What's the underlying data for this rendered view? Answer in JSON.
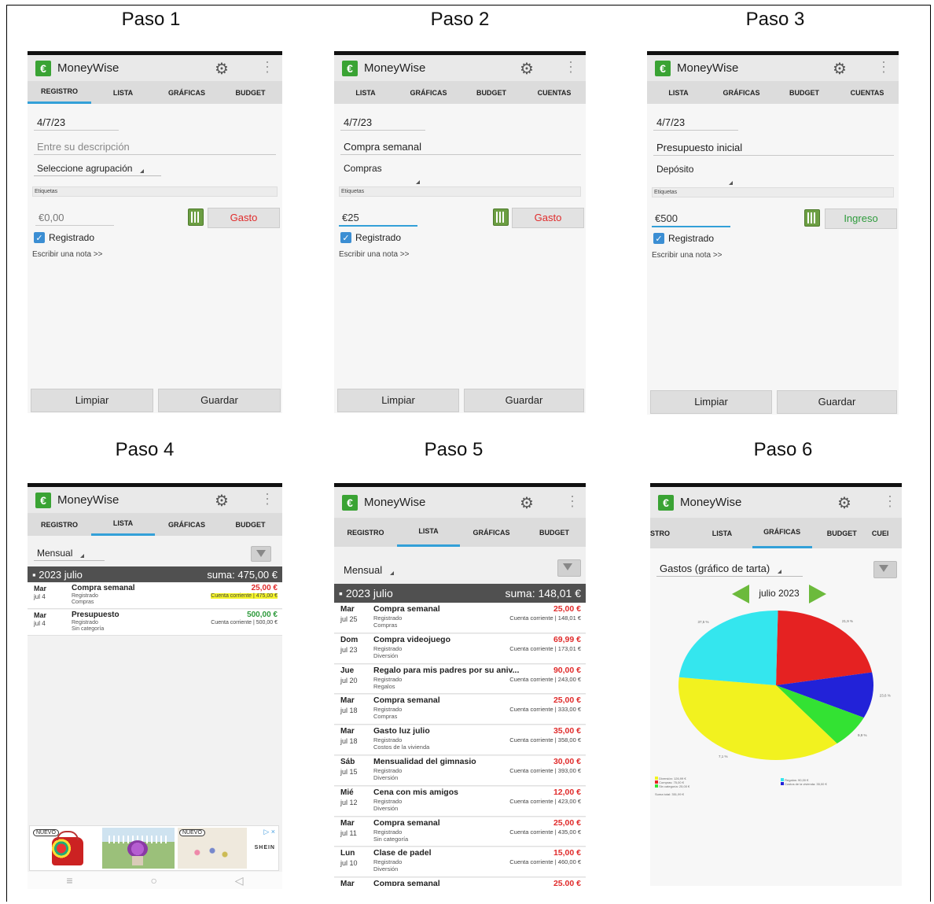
{
  "steps": [
    "Paso 1",
    "Paso 2",
    "Paso 3",
    "Paso 4",
    "Paso 5",
    "Paso 6"
  ],
  "app": {
    "logo": "€",
    "title": "MoneyWise",
    "gear_icon": "gear-icon",
    "menu_icon": "overflow-menu-icon"
  },
  "s1": {
    "tabs": [
      "REGISTRO",
      "LISTA",
      "GRÁFICAS",
      "BUDGET"
    ],
    "date": "4/7/23",
    "description_placeholder": "Entre su descripción",
    "group": "Seleccione agrupación",
    "tags": "Etiquetas",
    "amount": "€0,00",
    "type": "Gasto",
    "checked": "Registrado",
    "note": "Escribir una nota >>",
    "clear": "Limpiar",
    "save": "Guardar"
  },
  "s2": {
    "tabs": [
      "LISTA",
      "GRÁFICAS",
      "BUDGET",
      "CUENTAS"
    ],
    "date": "4/7/23",
    "description": "Compra semanal",
    "group": "Compras",
    "tags": "Etiquetas",
    "amount": "€25",
    "type": "Gasto",
    "checked": "Registrado",
    "note": "Escribir una nota >>",
    "clear": "Limpiar",
    "save": "Guardar"
  },
  "s3": {
    "tabs": [
      "LISTA",
      "GRÁFICAS",
      "BUDGET",
      "CUENTAS"
    ],
    "date": "4/7/23",
    "description": "Presupuesto inicial",
    "group": "Depósito",
    "tags": "Etiquetas",
    "amount": "€500",
    "type": "Ingreso",
    "checked": "Registrado",
    "note": "Escribir una nota >>",
    "clear": "Limpiar",
    "save": "Guardar"
  },
  "s4": {
    "tabs": [
      "REGISTRO",
      "LISTA",
      "GRÁFICAS",
      "BUDGET"
    ],
    "period": "Mensual",
    "month": "2023 julio",
    "sum": "suma: 475,00 €",
    "rows": [
      {
        "day": "Mar",
        "date": "jul 4",
        "title": "Compra semanal",
        "status": "Registrado",
        "cat": "Compras",
        "amount": "25,00 €",
        "account": "Cuenta corriente | 475,00 €",
        "kind": "expense"
      },
      {
        "day": "Mar",
        "date": "jul 4",
        "title": "Presupuesto",
        "status": "Registrado",
        "cat": "Sin categoría",
        "amount": "500,00 €",
        "account": "Cuenta corriente | 500,00 €",
        "kind": "income"
      }
    ],
    "ad": {
      "badge1": "NUEVO",
      "badge2": "NUEVO",
      "brand": "SHEIN",
      "adchoices": "▷ ×"
    },
    "nav": [
      "≡",
      "○",
      "◁"
    ]
  },
  "s5": {
    "tabs": [
      "REGISTRO",
      "LISTA",
      "GRÁFICAS",
      "BUDGET"
    ],
    "period": "Mensual",
    "month": "2023 julio",
    "sum": "suma: 148,01 €",
    "rows": [
      {
        "day": "Mar",
        "date": "jul 25",
        "title": "Compra semanal",
        "status": "Registrado",
        "cat": "Compras",
        "amount": "25,00 €",
        "account": "Cuenta corriente | 148,01 €"
      },
      {
        "day": "Dom",
        "date": "jul 23",
        "title": "Compra videojuego",
        "status": "Registrado",
        "cat": "Diversión",
        "amount": "69,99 €",
        "account": "Cuenta corriente | 173,01 €"
      },
      {
        "day": "Jue",
        "date": "jul 20",
        "title": "Regalo para mis padres por su aniv...",
        "status": "Registrado",
        "cat": "Regalos",
        "amount": "90,00 €",
        "account": "Cuenta corriente | 243,00 €"
      },
      {
        "day": "Mar",
        "date": "jul 18",
        "title": "Compra semanal",
        "status": "Registrado",
        "cat": "Compras",
        "amount": "25,00 €",
        "account": "Cuenta corriente | 333,00 €"
      },
      {
        "day": "Mar",
        "date": "jul 18",
        "title": "Gasto luz julio",
        "status": "Registrado",
        "cat": "Costos de la vivienda",
        "amount": "35,00 €",
        "account": "Cuenta corriente | 358,00 €"
      },
      {
        "day": "Sáb",
        "date": "jul 15",
        "title": "Mensualidad del gimnasio",
        "status": "Registrado",
        "cat": "Diversión",
        "amount": "30,00 €",
        "account": "Cuenta corriente | 393,00 €"
      },
      {
        "day": "Mié",
        "date": "jul 12",
        "title": "Cena con mis amigos",
        "status": "Registrado",
        "cat": "Diversión",
        "amount": "12,00 €",
        "account": "Cuenta corriente | 423,00 €"
      },
      {
        "day": "Mar",
        "date": "jul 11",
        "title": "Compra semanal",
        "status": "Registrado",
        "cat": "Sin categoría",
        "amount": "25,00 €",
        "account": "Cuenta corriente | 435,00 €"
      },
      {
        "day": "Lun",
        "date": "jul 10",
        "title": "Clase de padel",
        "status": "Registrado",
        "cat": "Diversión",
        "amount": "15,00 €",
        "account": "Cuenta corriente | 460,00 €"
      },
      {
        "day": "Mar",
        "date": "",
        "title": "Compra semanal",
        "status": "",
        "cat": "",
        "amount": "25,00 €",
        "account": ""
      }
    ]
  },
  "s6": {
    "tabs": [
      "STRO",
      "LISTA",
      "GRÁFICAS",
      "BUDGET",
      "CUEI"
    ],
    "chart_selector": "Gastos (gráfico de tarta)",
    "month": "julio 2023",
    "pct_labels": [
      "21,9 %",
      "23,6 %",
      "9,9 %",
      "7,1 %",
      "37,5 %"
    ],
    "legend": [
      "Diversión: 126,99 €",
      "Compras: 75,00 €",
      "Sin categoría: 25,00 €",
      "Regalos: 90,00 €",
      "Costos de la vivienda: 35,00 €"
    ],
    "total": "Suma total: 351,99 €"
  },
  "chart_data": {
    "type": "pie",
    "title": "Gastos (gráfico de tarta)",
    "subtitle": "julio 2023",
    "slices": [
      {
        "label": "Regalos",
        "value": 21.9,
        "color": "#e52222"
      },
      {
        "label": "Costos de la vivienda",
        "value": 9.9,
        "color": "#2222d8"
      },
      {
        "label": "Sin categoría",
        "value": 7.1,
        "color": "#33e233"
      },
      {
        "label": "Diversión",
        "value": 37.5,
        "color": "#f2f21f"
      },
      {
        "label": "Compras",
        "value": 23.6,
        "color": "#34e6ee"
      }
    ]
  }
}
